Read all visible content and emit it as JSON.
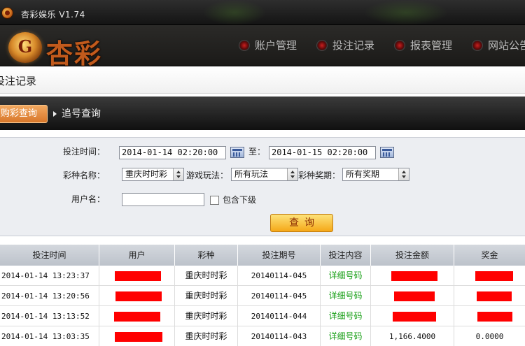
{
  "window": {
    "title": "杏彩娱乐 V1.74"
  },
  "logo": {
    "badge": "G",
    "text": "杏彩"
  },
  "nav": {
    "items": [
      {
        "label": "账户管理"
      },
      {
        "label": "投注记录"
      },
      {
        "label": "报表管理"
      },
      {
        "label": "网站公告"
      }
    ]
  },
  "section": {
    "title": "投注记录"
  },
  "tabs": {
    "active": "购彩查询",
    "inactive": "追号查询"
  },
  "form": {
    "time_label": "投注时间：",
    "time_from": "2014-01-14 02:20:00",
    "to_label": "至：",
    "time_to": "2014-01-15 02:20:00",
    "lottery_label": "彩种名称：",
    "lottery_value": "重庆时时彩",
    "play_label": "游戏玩法：",
    "play_value": "所有玩法",
    "issue_label": "彩种奖期：",
    "issue_value": "所有奖期",
    "user_label": "用户名：",
    "user_value": "",
    "include_sub_label": "包含下级",
    "query_button": "查询"
  },
  "table": {
    "headers": [
      "投注时间",
      "用户",
      "彩种",
      "投注期号",
      "投注内容",
      "投注金额",
      "奖金"
    ],
    "rows": [
      {
        "time": "2014-01-14 13:23:37",
        "lottery": "重庆时时彩",
        "issue": "20140114-045",
        "content": "详细号码",
        "amount": "",
        "prize": ""
      },
      {
        "time": "2014-01-14 13:20:56",
        "lottery": "重庆时时彩",
        "issue": "20140114-045",
        "content": "详细号码",
        "amount": "",
        "prize": ""
      },
      {
        "time": "2014-01-14 13:13:52",
        "lottery": "重庆时时彩",
        "issue": "20140114-044",
        "content": "详细号码",
        "amount": "",
        "prize": ""
      },
      {
        "time": "2014-01-14 13:03:35",
        "lottery": "重庆时时彩",
        "issue": "20140114-043",
        "content": "详细号码",
        "amount": "1,166.4000",
        "prize": "0.0000"
      }
    ]
  },
  "colors": {
    "accent": "#f5a818",
    "link": "#1aa018",
    "redaction": "#ff0000"
  }
}
